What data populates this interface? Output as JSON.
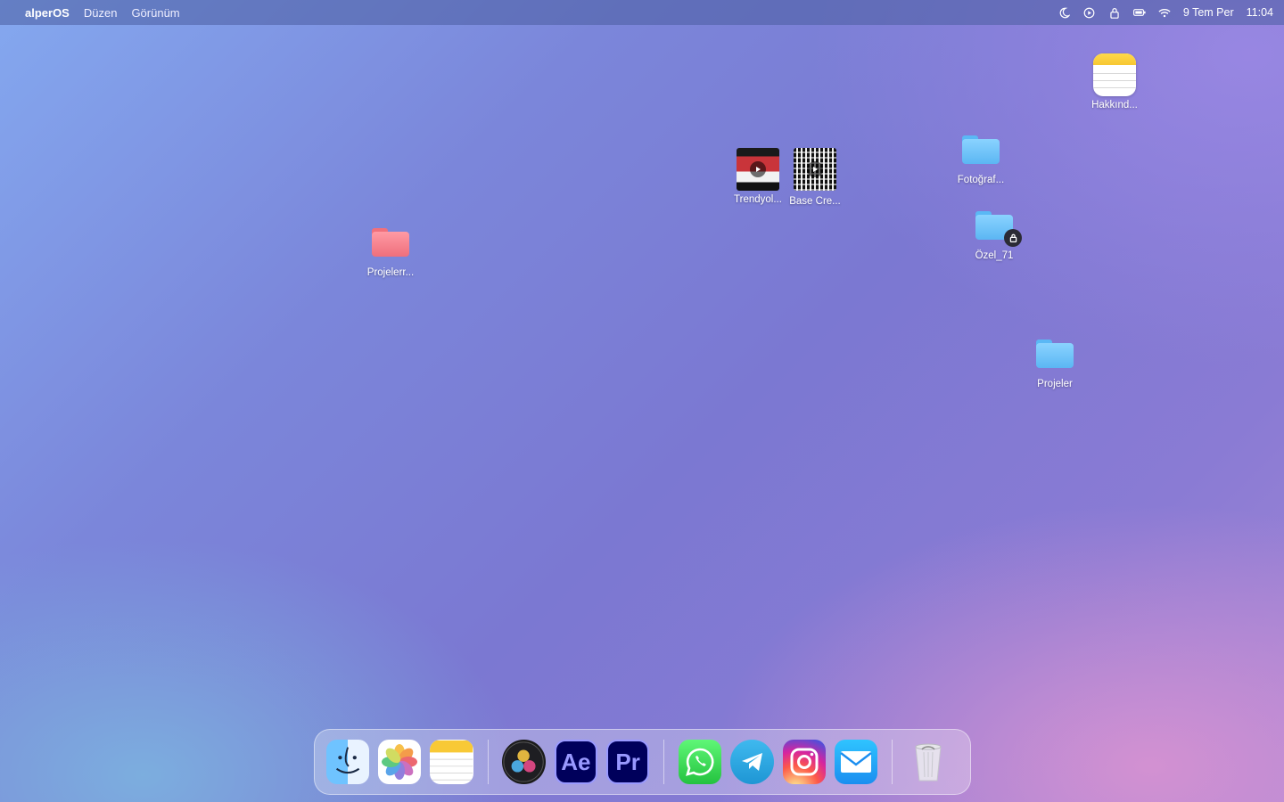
{
  "menubar": {
    "brand": "alperOS",
    "menus": [
      "Düzen",
      "Görünüm"
    ],
    "status_icons": [
      "moon-icon",
      "play-circle-icon",
      "lock-icon",
      "battery-icon",
      "wifi-icon"
    ],
    "date": "9 Tem Per",
    "time": "11:04"
  },
  "desktop": {
    "items": [
      {
        "label": "Hakkınd...",
        "type": "notes-file"
      },
      {
        "label": "Trendyol...",
        "type": "video"
      },
      {
        "label": "Base Cre...",
        "type": "video"
      },
      {
        "label": "Fotoğraf...",
        "type": "folder",
        "color": "#5bb6f3"
      },
      {
        "label": "Özel_71",
        "type": "folder-locked",
        "color": "#5bb6f3"
      },
      {
        "label": "Projelerr...",
        "type": "folder",
        "color": "#ee6f7c"
      },
      {
        "label": "Projeler",
        "type": "folder",
        "color": "#5bb6f3"
      }
    ]
  },
  "dock": {
    "apps": [
      {
        "name": "Finder",
        "icon": "finder-icon"
      },
      {
        "name": "Photos",
        "icon": "photos-icon"
      },
      {
        "name": "Notes",
        "icon": "notes-icon"
      },
      {
        "name": "DaVinci Resolve",
        "icon": "davinci-resolve-icon"
      },
      {
        "name": "After Effects",
        "icon": "after-effects-icon",
        "text": "Ae"
      },
      {
        "name": "Premiere Pro",
        "icon": "premiere-pro-icon",
        "text": "Pr"
      },
      {
        "name": "WhatsApp",
        "icon": "whatsapp-icon"
      },
      {
        "name": "Telegram",
        "icon": "telegram-icon"
      },
      {
        "name": "Instagram",
        "icon": "instagram-icon"
      },
      {
        "name": "Mail",
        "icon": "mail-icon"
      },
      {
        "name": "Trash",
        "icon": "trash-icon"
      }
    ]
  }
}
